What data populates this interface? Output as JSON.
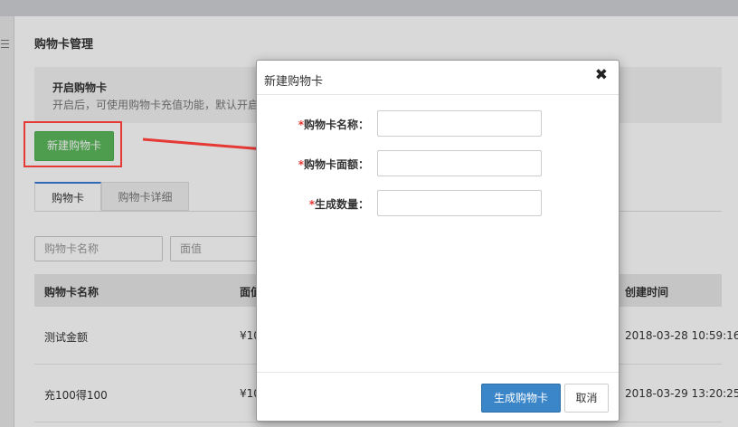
{
  "page": {
    "title": "购物卡管理",
    "notice_title": "开启购物卡",
    "notice_text": "开启后，可使用购物卡充值功能，默认开启"
  },
  "toolbar": {
    "new_card_label": "新建购物卡"
  },
  "tabs": [
    {
      "label": "购物卡"
    },
    {
      "label": "购物卡详细"
    }
  ],
  "filters": {
    "name_placeholder": "购物卡名称",
    "value_placeholder": "面值"
  },
  "table": {
    "headers": [
      "购物卡名称",
      "面值",
      "创建时间"
    ],
    "rows": [
      {
        "name": "测试金额",
        "value": "¥10",
        "created": "2018-03-28 10:59:16"
      },
      {
        "name": "充100得100",
        "value": "¥10",
        "created": "2018-03-29 13:20:25"
      }
    ]
  },
  "modal": {
    "title": "新建购物卡",
    "close_glyph": "✖",
    "required_mark": "*",
    "fields": [
      {
        "label": "购物卡名称：",
        "value": ""
      },
      {
        "label": "购物卡面额：",
        "value": ""
      },
      {
        "label": "生成数量：",
        "value": ""
      }
    ],
    "submit_label": "生成购物卡",
    "cancel_label": "取消"
  },
  "colors": {
    "green_button": "#5cb85c",
    "primary_button": "#3a86c8",
    "annotation_red": "#e53935",
    "tab_accent": "#3a7bd5"
  }
}
